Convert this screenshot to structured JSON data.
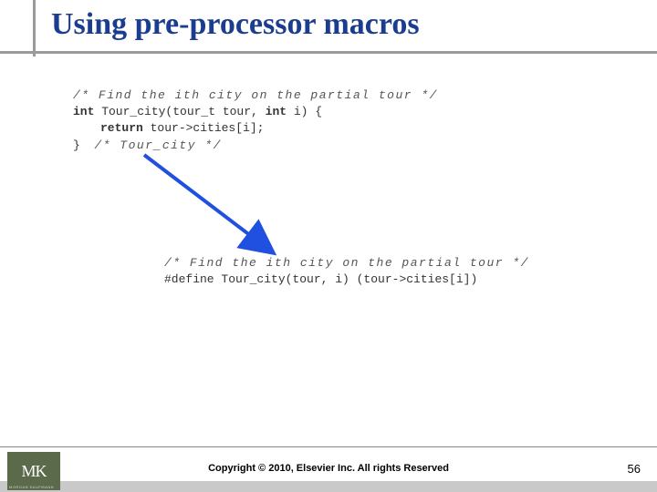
{
  "title": "Using pre-processor macros",
  "code1": {
    "line1": "/* Find the ith city on the partial tour */",
    "line2a": "int",
    "line2b": " Tour_city(tour_t tour, ",
    "line2c": "int",
    "line2d": " i) {",
    "line3a": "return",
    "line3b": " tour->cities[i];",
    "line4": "}  /* Tour_city */"
  },
  "code2": {
    "line1": "/* Find the ith city on the partial tour */",
    "line2": "#define Tour_city(tour, i) (tour->cities[i])"
  },
  "footer": {
    "copyright": "Copyright © 2010, Elsevier Inc. All rights Reserved",
    "page": "56",
    "logo": "MK",
    "logo_sub": "MORGAN KAUFMANN"
  }
}
